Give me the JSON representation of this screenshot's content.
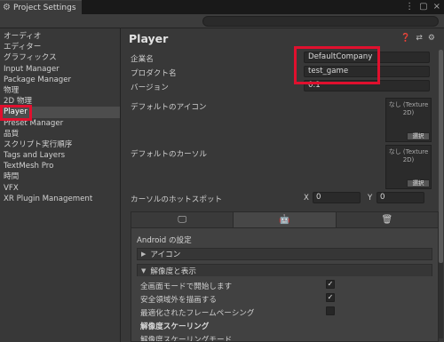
{
  "window": {
    "tab_title": "Project Settings",
    "more_icon": "⋮",
    "max_icon": "▢",
    "close_icon": "×"
  },
  "search": {
    "placeholder": "",
    "value": ""
  },
  "sidebar": {
    "items": [
      {
        "label": "オーディオ"
      },
      {
        "label": "エディター"
      },
      {
        "label": "グラフィックス"
      },
      {
        "label": "Input Manager"
      },
      {
        "label": "Package Manager"
      },
      {
        "label": "物理"
      },
      {
        "label": "2D 物理"
      },
      {
        "label": "Player",
        "selected": true
      },
      {
        "label": "Preset Manager"
      },
      {
        "label": "品質"
      },
      {
        "label": "スクリプト実行順序"
      },
      {
        "label": "Tags and Layers"
      },
      {
        "label": "TextMesh Pro"
      },
      {
        "label": "時間"
      },
      {
        "label": "VFX"
      },
      {
        "label": "XR Plugin Management"
      }
    ]
  },
  "main": {
    "title": "Player",
    "company_label": "企業名",
    "company_value": "DefaultCompany",
    "product_label": "プロダクト名",
    "product_value": "test_game",
    "version_label": "バージョン",
    "version_value": "0.1",
    "default_icon_label": "デフォルトのアイコン",
    "default_cursor_label": "デフォルトのカーソル",
    "texture_none_1": "なし (Texture",
    "texture_none_2": "2D)",
    "select_label": "選択",
    "hotspot_label": "カーソルのホットスポット",
    "x_label": "X",
    "x_value": "0",
    "y_label": "Y",
    "y_value": "0"
  },
  "platform": {
    "tabs": [
      {
        "icon": "monitor-icon",
        "glyph": "🖵"
      },
      {
        "icon": "android-icon",
        "glyph": "🤖"
      },
      {
        "icon": "webgl-icon",
        "glyph": "🗑"
      }
    ],
    "android_title": "Android の設定",
    "icon_section": "アイコン",
    "resolution_section": "解像度と表示",
    "options": [
      {
        "label": "全画面モードで開始します",
        "checked": true
      },
      {
        "label": "安全領域外を描画する",
        "checked": true
      },
      {
        "label": "最適化されたフレームペーシング",
        "checked": false
      }
    ],
    "scaling_heading": "解像度スケーリング",
    "cut_row": "解像度スケーリングモード"
  },
  "highlight_color": "#e0102e"
}
